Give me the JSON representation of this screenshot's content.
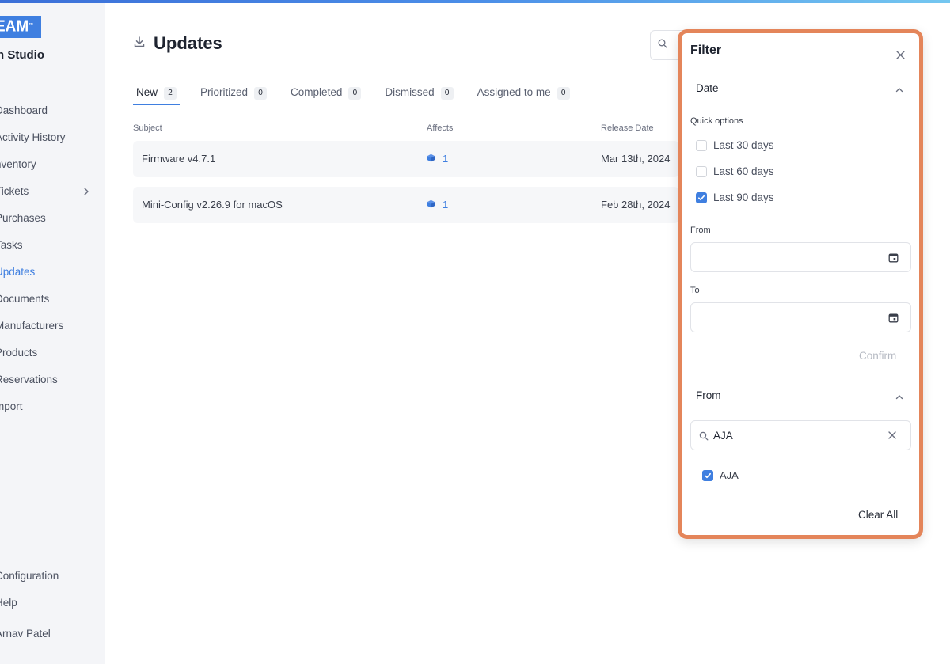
{
  "brand": {
    "logo_text": "EAM",
    "trademark": "™",
    "app_name": "n Studio"
  },
  "sidebar": {
    "items": [
      {
        "label": "Dashboard",
        "active": false
      },
      {
        "label": "Activity History",
        "active": false
      },
      {
        "label": "nventory",
        "active": false
      },
      {
        "label": "Tickets",
        "active": false,
        "has_submenu": true
      },
      {
        "label": "Purchases",
        "active": false
      },
      {
        "label": "Tasks",
        "active": false
      },
      {
        "label": "Updates",
        "active": true
      },
      {
        "label": "Documents",
        "active": false
      },
      {
        "label": "Manufacturers",
        "active": false
      },
      {
        "label": "Products",
        "active": false
      },
      {
        "label": "Reservations",
        "active": false
      },
      {
        "label": "mport",
        "active": false
      }
    ],
    "bottom_items": [
      {
        "label": "Configuration"
      },
      {
        "label": "Help"
      }
    ],
    "user": "Arnav Patel"
  },
  "page": {
    "title": "Updates"
  },
  "tabs": [
    {
      "label": "New",
      "count": "2",
      "active": true
    },
    {
      "label": "Prioritized",
      "count": "0",
      "active": false
    },
    {
      "label": "Completed",
      "count": "0",
      "active": false
    },
    {
      "label": "Dismissed",
      "count": "0",
      "active": false
    },
    {
      "label": "Assigned to me",
      "count": "0",
      "active": false
    }
  ],
  "table": {
    "columns": [
      "Subject",
      "Affects",
      "Release Date"
    ],
    "rows": [
      {
        "subject": "Firmware v4.7.1",
        "affects": "1",
        "release_date": "Mar 13th, 2024"
      },
      {
        "subject": "Mini-Config v2.26.9 for macOS",
        "affects": "1",
        "release_date": "Feb 28th, 2024"
      }
    ]
  },
  "filter": {
    "title": "Filter",
    "date_section": {
      "heading": "Date",
      "quick_label": "Quick options",
      "options": [
        {
          "label": "Last 30 days",
          "checked": false
        },
        {
          "label": "Last 60 days",
          "checked": false
        },
        {
          "label": "Last 90 days",
          "checked": true
        }
      ],
      "from_label": "From",
      "from_value": "",
      "to_label": "To",
      "to_value": "",
      "confirm_label": "Confirm"
    },
    "from_section": {
      "heading": "From",
      "search_value": "AJA",
      "results": [
        {
          "label": "AJA",
          "checked": true
        }
      ]
    },
    "clear_label": "Clear All"
  },
  "colors": {
    "accent": "#3f7fe0",
    "highlight_border": "#e4855a",
    "sidebar_bg": "#f4f5f8",
    "row_bg": "#f6f7f9"
  }
}
